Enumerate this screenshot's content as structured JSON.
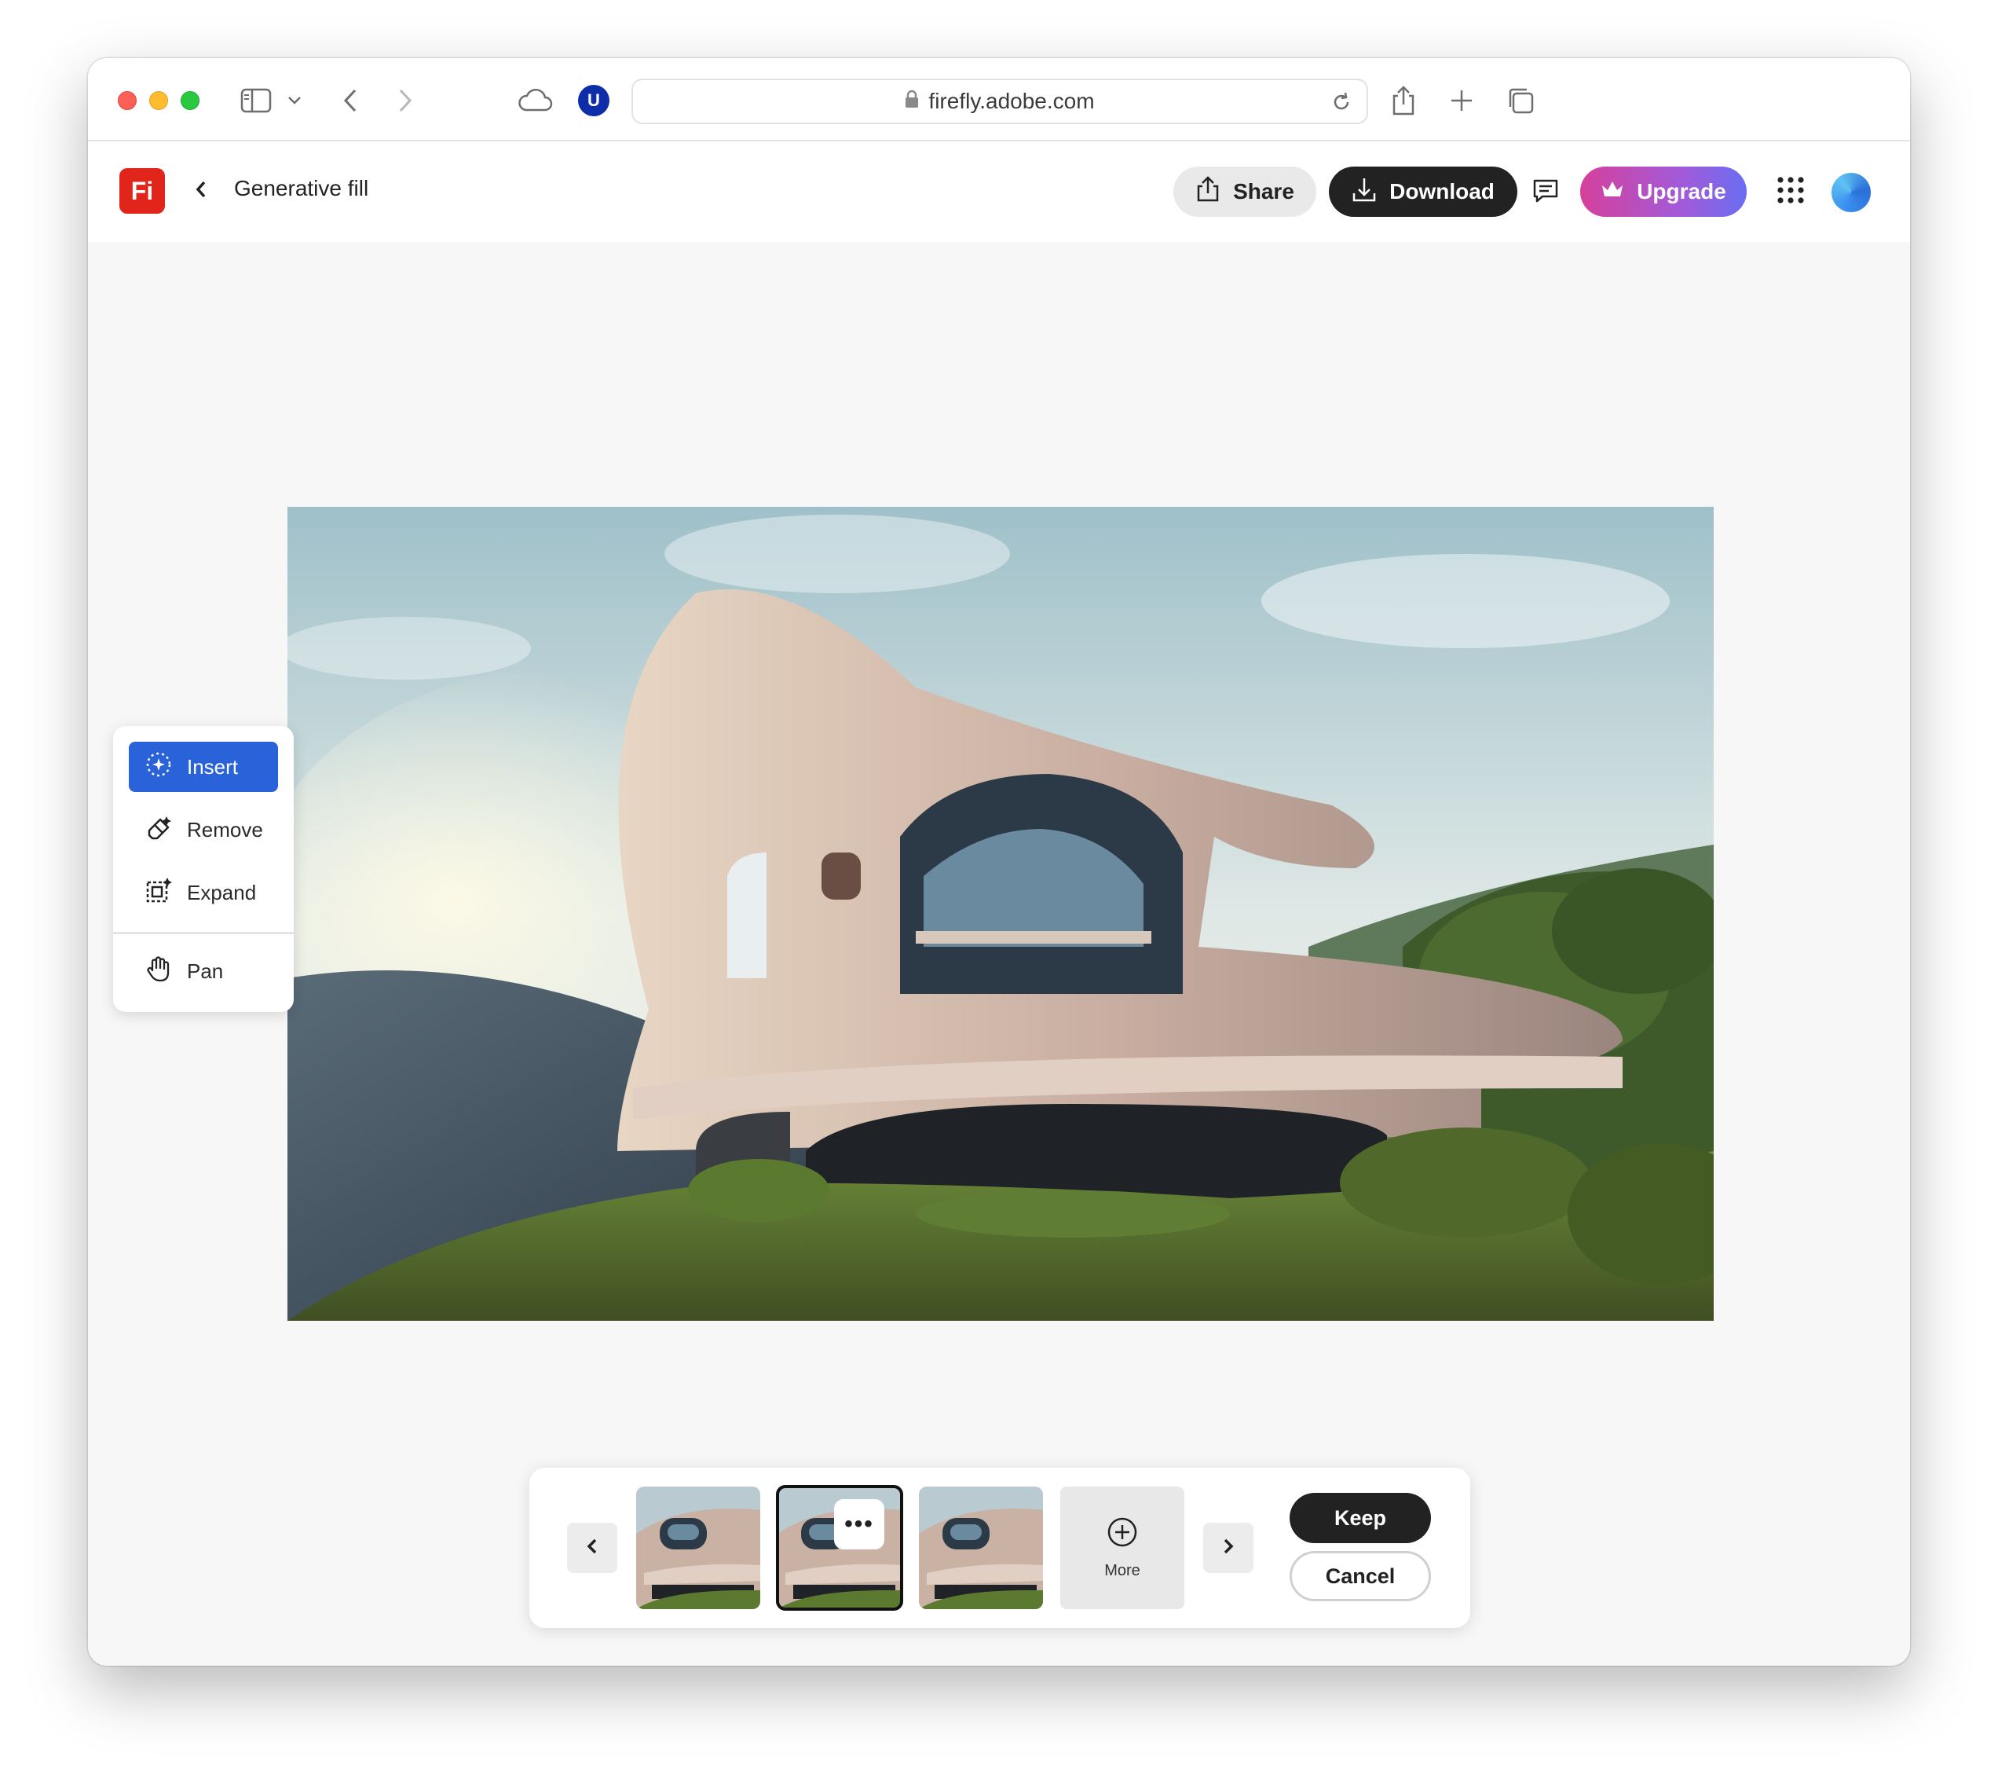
{
  "browser": {
    "url": "firefly.adobe.com",
    "extension_badge": "U"
  },
  "app": {
    "logo_text": "Fi",
    "page_title": "Generative fill",
    "share_label": "Share",
    "download_label": "Download",
    "upgrade_label": "Upgrade",
    "colors": {
      "logo": "#e1251b",
      "download_bg": "#222222",
      "upgrade_gradient": [
        "#d5409a",
        "#6a6df0"
      ],
      "active_tool": "#2a63d9"
    }
  },
  "tools": {
    "items": [
      {
        "label": "Insert",
        "icon": "insert-sparkle-icon",
        "active": true
      },
      {
        "label": "Remove",
        "icon": "eraser-icon",
        "active": false
      },
      {
        "label": "Expand",
        "icon": "expand-icon",
        "active": false
      },
      {
        "label": "Pan",
        "icon": "hand-icon",
        "active": false
      }
    ]
  },
  "tray": {
    "variations": [
      {
        "selected": false
      },
      {
        "selected": true,
        "has_menu": true
      },
      {
        "selected": false
      }
    ],
    "more_label": "More",
    "keep_label": "Keep",
    "cancel_label": "Cancel"
  }
}
